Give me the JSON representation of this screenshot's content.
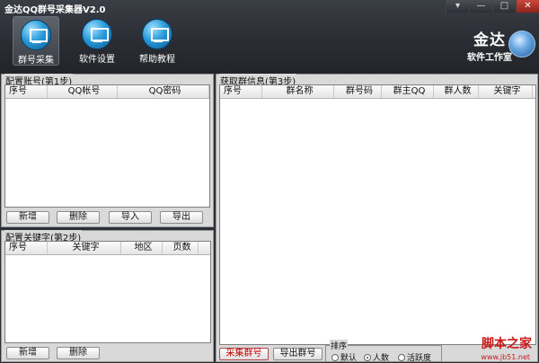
{
  "app": {
    "title": "金达QQ群号采集器V2.0"
  },
  "window": {
    "restore": "▾",
    "minimize": "—",
    "maximize": "□",
    "close": "✕"
  },
  "toolbar": {
    "items": [
      {
        "label": "群号采集",
        "icon": "monitor-icon"
      },
      {
        "label": "软件设置",
        "icon": "monitor-icon"
      },
      {
        "label": "帮助教程",
        "icon": "monitor-icon"
      }
    ]
  },
  "brand": {
    "line1": "金达",
    "line2": "软件工作室"
  },
  "account_panel": {
    "title": "配置账号(第1步)",
    "columns": [
      "序号",
      "QQ帐号",
      "QQ密码"
    ],
    "buttons": [
      "新增",
      "删除",
      "导入",
      "导出"
    ]
  },
  "keyword_panel": {
    "title": "配置关键字(第2步)",
    "columns": [
      "序号",
      "关键字",
      "地区",
      "页数"
    ],
    "buttons": [
      "新增",
      "删除"
    ]
  },
  "group_panel": {
    "title": "获取群信息(第3步)",
    "columns": [
      "序号",
      "群名称",
      "群号码",
      "群主QQ",
      "群人数",
      "关键字"
    ],
    "buttons": {
      "collect": "采集群号",
      "export": "导出群号"
    }
  },
  "sort": {
    "title": "排序",
    "options": [
      "默认",
      "人数",
      "活跃度"
    ],
    "selected": "人数"
  },
  "watermark": {
    "text": "脚本之家",
    "url": "www.jb51.net"
  }
}
